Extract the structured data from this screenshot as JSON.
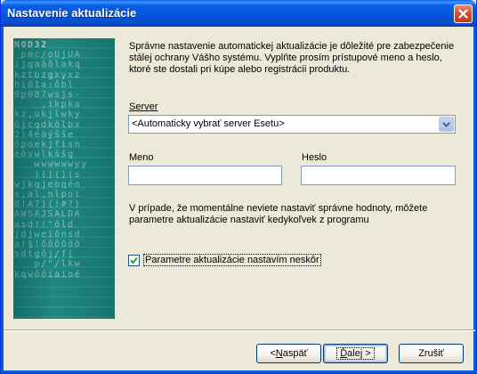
{
  "window": {
    "title": "Nastavenie aktualizácie"
  },
  "banner": {
    "brand": "NOD32",
    "lines": [
      "NOD32",
      " pmc/oUjUA",
      "ijqaâôlakq",
      "kztbzgxyxz",
      "hiö1a:ôbl",
      "0p087wsjs-",
      "    ,ikpka",
      "kz,ukjlwky",
      "ôjcqdkôlbx",
      "2)4éäýšše",
      "ôpoekjfisn",
      "éôvwlkššg",
      "   wwwwwwyy",
      "   )()()(s",
      "wjkqjeoqén",
      "s,al,nlpoi",
      "8!A?)(!#?)",
      "AWSAJSALDA",
      "asd!!\"ôld",
      "jdjweiônsd",
      "a!§!ôôôôôô",
      "sdtgôj/f[",
      "   p/\"/lkw",
      "kqwôôiaioé",
      "          ",
      "          ",
      "          ",
      "          "
    ]
  },
  "intro_text": "Správne nastavenie automatickej aktualizácie je dôležité pre zabezpečenie stálej ochrany Vášho systému. Vyplňte prosím prístupové meno a heslo, ktoré ste dostali pri kúpe alebo registrácii produktu.",
  "server": {
    "label": "Server",
    "selected": "<Automaticky vybrať server Esetu>"
  },
  "credentials": {
    "username_label": "Meno",
    "username_value": "",
    "password_label": "Heslo",
    "password_value": ""
  },
  "note_text": "V prípade, že momentálne neviete nastaviť správne hodnoty, môžete parametre aktualizácie nastaviť kedykoľvek z programu",
  "later_checkbox": {
    "label": "Parametre aktualizácie nastavím neskôr",
    "checked": true
  },
  "buttons": {
    "back_prefix": "< ",
    "back_hotkey": "N",
    "back_rest": "aspäť",
    "next_hotkey": "Ď",
    "next_rest": "alej >",
    "cancel_label": "Zrušiť"
  },
  "colors": {
    "title_bar": "#0454d6",
    "banner": "#2a9d93",
    "close_button": "#d7512e"
  },
  "icons": {
    "close": "close-icon",
    "dropdown": "chevron-down-icon",
    "check": "checkmark-icon"
  }
}
